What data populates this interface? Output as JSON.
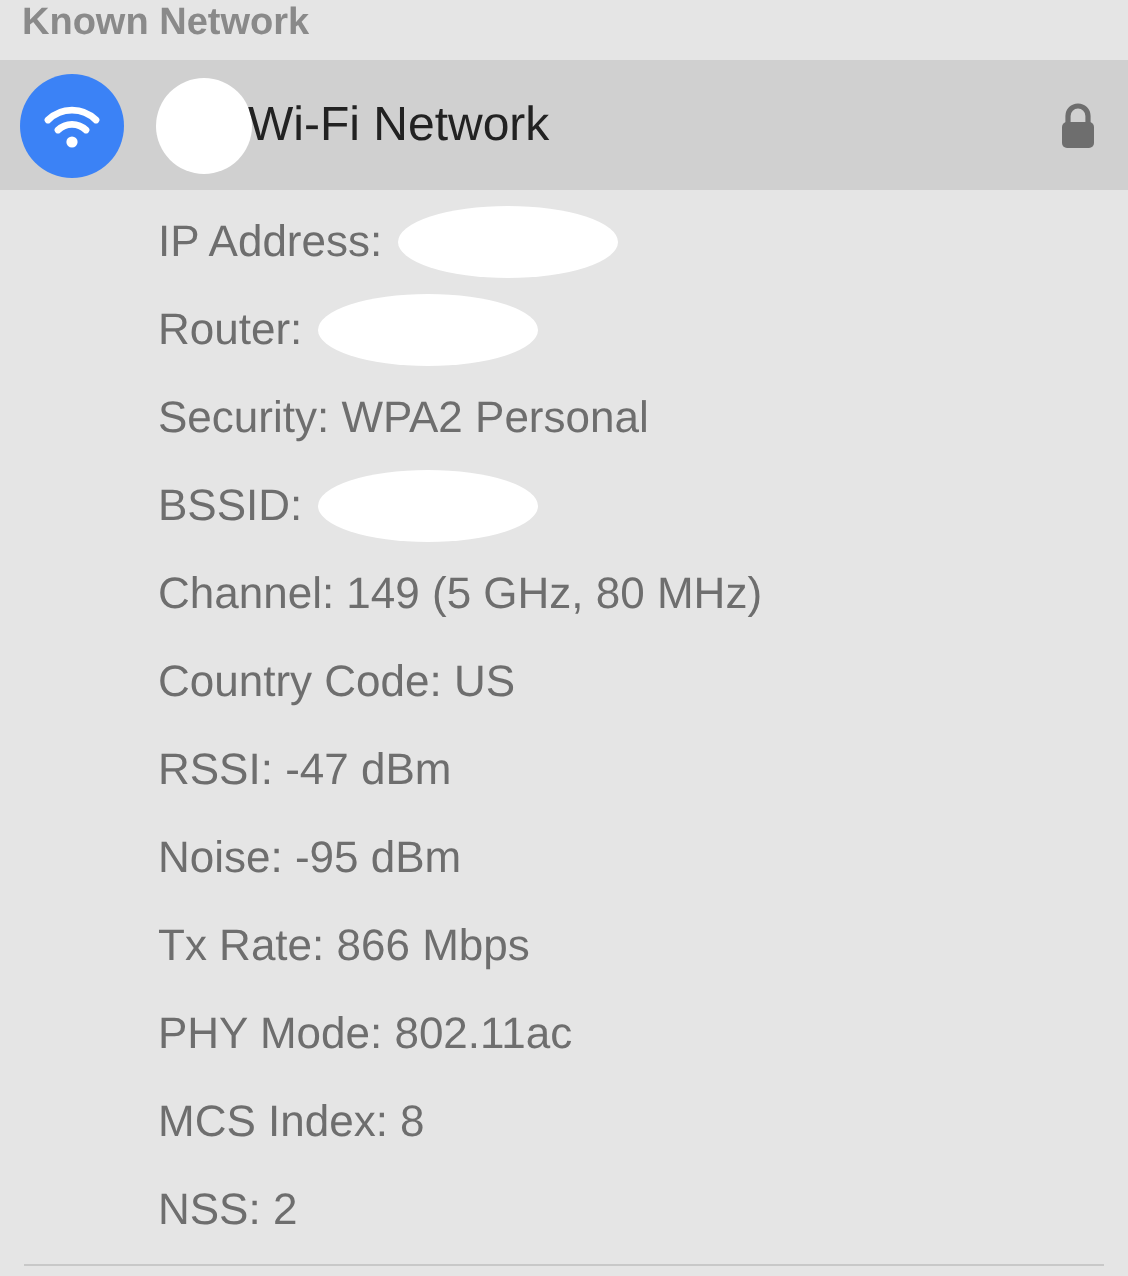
{
  "section_title": "Known Network",
  "network": {
    "name": "Wi-Fi Network",
    "selected": true,
    "locked": true,
    "redacted": true
  },
  "details": [
    {
      "text": "IP Address:",
      "redacted": true
    },
    {
      "text": "Router:",
      "redacted": true
    },
    {
      "text": "Security: WPA2 Personal",
      "redacted": false
    },
    {
      "text": "BSSID:",
      "redacted": true
    },
    {
      "text": "Channel: 149 (5 GHz, 80 MHz)",
      "redacted": false
    },
    {
      "text": "Country Code: US",
      "redacted": false
    },
    {
      "text": "RSSI: -47 dBm",
      "redacted": false
    },
    {
      "text": "Noise: -95 dBm",
      "redacted": false
    },
    {
      "text": "Tx Rate: 866 Mbps",
      "redacted": false
    },
    {
      "text": "PHY Mode: 802.11ac",
      "redacted": false
    },
    {
      "text": "MCS Index: 8",
      "redacted": false
    },
    {
      "text": "NSS: 2",
      "redacted": false
    }
  ]
}
